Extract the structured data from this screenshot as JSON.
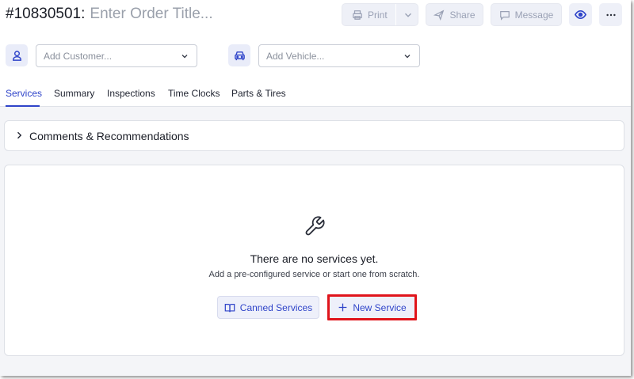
{
  "order": {
    "number": "#10830501:",
    "title_placeholder": "Enter Order Title..."
  },
  "toolbar": {
    "print_label": "Print",
    "share_label": "Share",
    "message_label": "Message"
  },
  "customer": {
    "placeholder": "Add Customer..."
  },
  "vehicle": {
    "placeholder": "Add Vehicle..."
  },
  "tabs": [
    {
      "label": "Services",
      "active": true
    },
    {
      "label": "Summary"
    },
    {
      "label": "Inspections"
    },
    {
      "label": "Time Clocks"
    },
    {
      "label": "Parts & Tires"
    }
  ],
  "comments": {
    "title": "Comments & Recommendations"
  },
  "services": {
    "empty_title": "There are no services yet.",
    "empty_subtitle": "Add a pre-configured service or start one from scratch.",
    "canned_label": "Canned Services",
    "new_label": "New Service"
  },
  "colors": {
    "accent": "#2f44c9",
    "highlight": "#e0141b"
  }
}
